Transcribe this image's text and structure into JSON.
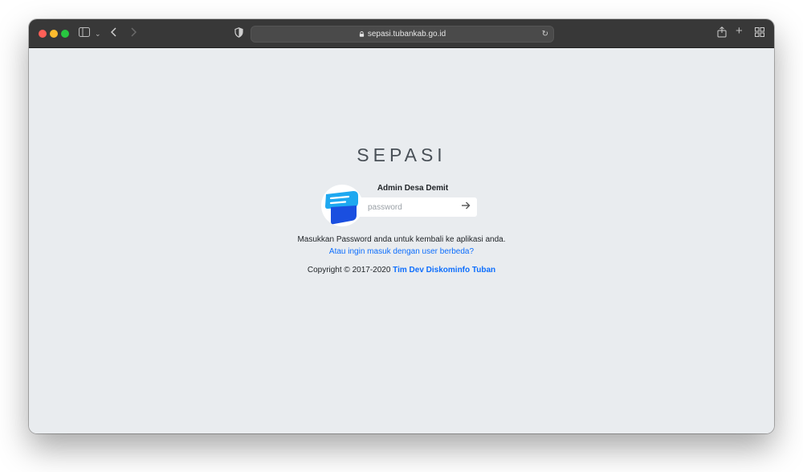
{
  "browser": {
    "url": "sepasi.tubankab.go.id"
  },
  "icons": {
    "sidebar": "sidebar-icon",
    "back": "chevron-left-icon",
    "forward": "chevron-right-icon",
    "privacy": "shield-icon",
    "lock": "lock-icon",
    "reload": "reload-icon",
    "share": "share-icon",
    "new_tab": "plus-icon",
    "tabs": "grid-icon"
  },
  "colors": {
    "background": "#e9ecef",
    "link": "#0d6efd",
    "brand_text": "#495057"
  },
  "login": {
    "brand": "SEPASI",
    "user_name": "Admin Desa Demit",
    "password_placeholder": "password",
    "help_text": "Masukkan Password anda untuk kembali ke aplikasi anda.",
    "switch_user_link": "Atau ingin masuk dengan user berbeda?",
    "copyright_prefix": "Copyright © 2017-2020",
    "copyright_link": "Tim Dev Diskominfo Tuban"
  }
}
